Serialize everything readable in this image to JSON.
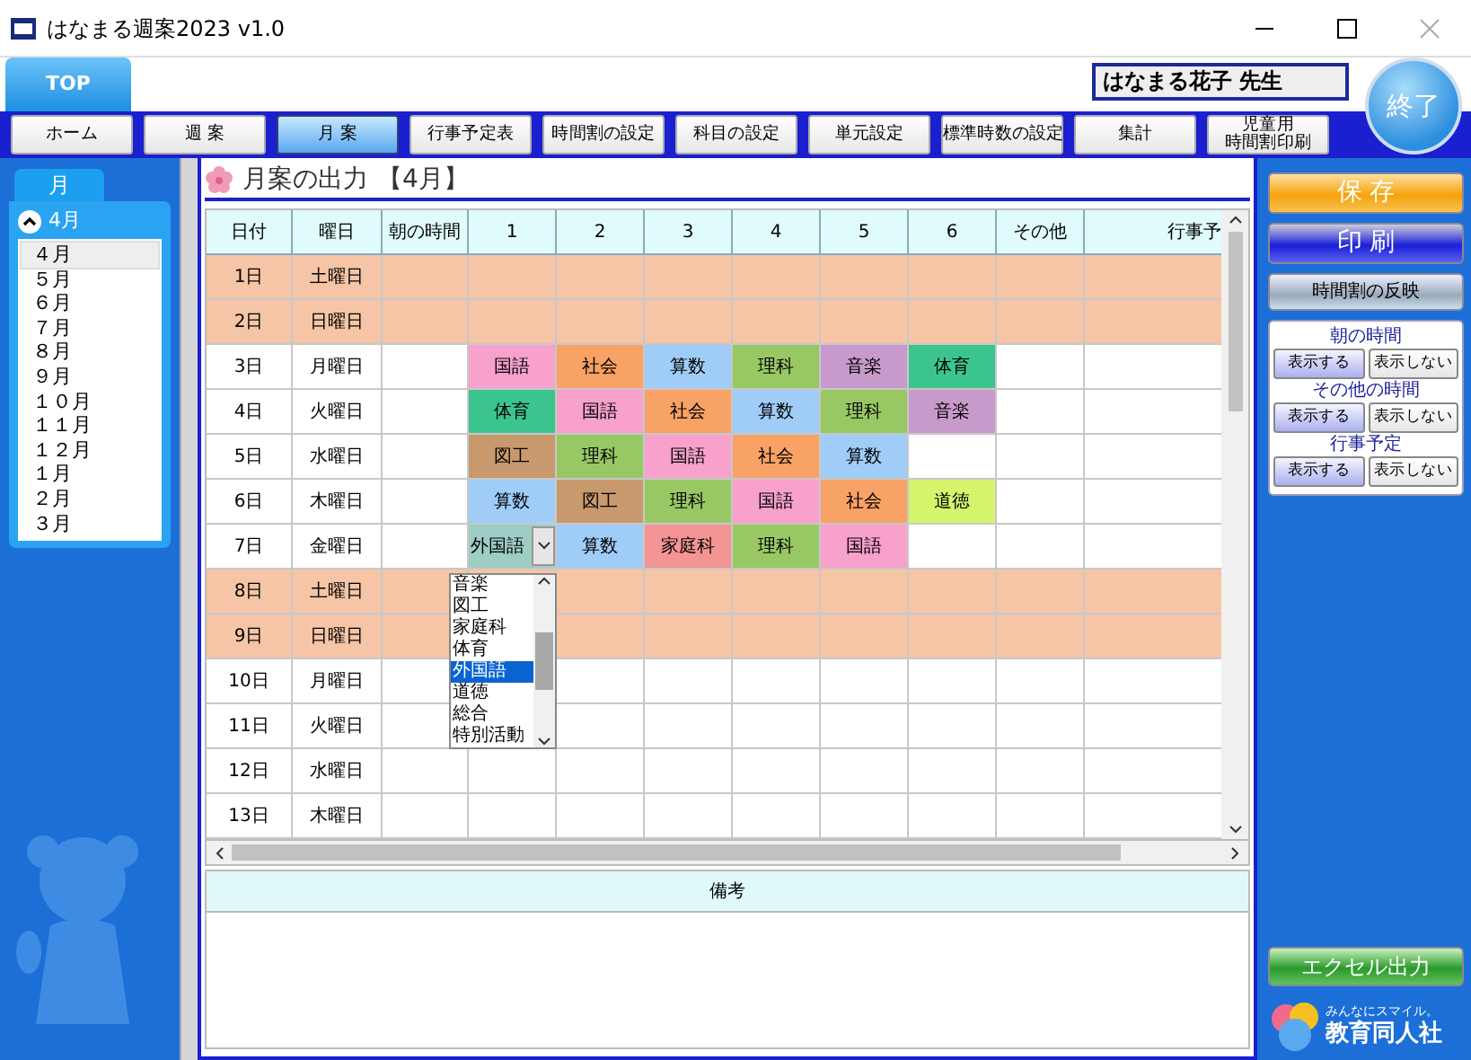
{
  "window": {
    "title": "はなまる週案2023 v1.0"
  },
  "top_tab": {
    "label": "TOP",
    "selected": true
  },
  "teacher": "はなまる花子 先生",
  "exit_button": "終了",
  "nav": [
    {
      "lines": [
        "ホーム"
      ],
      "selected": false
    },
    {
      "lines": [
        "週 案"
      ],
      "selected": false
    },
    {
      "lines": [
        "月 案"
      ],
      "selected": true
    },
    {
      "lines": [
        "行事予定表"
      ],
      "selected": false
    },
    {
      "lines": [
        "時間割の設定"
      ],
      "selected": false
    },
    {
      "lines": [
        "科目の設定"
      ],
      "selected": false
    },
    {
      "lines": [
        "単元設定"
      ],
      "selected": false
    },
    {
      "lines": [
        "標準時数の設定"
      ],
      "selected": false
    },
    {
      "lines": [
        "集計"
      ],
      "selected": false
    },
    {
      "lines": [
        "児童用",
        "時間割印刷"
      ],
      "selected": false
    }
  ],
  "month_panel": {
    "tab": "月",
    "current": "4月",
    "months": [
      {
        "label": "４月",
        "selected": true
      },
      {
        "label": "５月",
        "selected": false
      },
      {
        "label": "６月",
        "selected": false
      },
      {
        "label": "７月",
        "selected": false
      },
      {
        "label": "８月",
        "selected": false
      },
      {
        "label": "９月",
        "selected": false
      },
      {
        "label": "１０月",
        "selected": false
      },
      {
        "label": "１１月",
        "selected": false
      },
      {
        "label": "１２月",
        "selected": false
      },
      {
        "label": "１月",
        "selected": false
      },
      {
        "label": "２月",
        "selected": false
      },
      {
        "label": "３月",
        "selected": false
      }
    ]
  },
  "panel": {
    "title": "月案の出力",
    "month": "【4月】"
  },
  "table": {
    "columns": [
      "日付",
      "曜日",
      "朝の時間",
      "1",
      "2",
      "3",
      "4",
      "5",
      "6",
      "その他",
      "行事予"
    ],
    "rows": [
      {
        "date": "1日",
        "weekday": "土曜日",
        "holiday": true,
        "periods": []
      },
      {
        "date": "2日",
        "weekday": "日曜日",
        "holiday": true,
        "periods": []
      },
      {
        "date": "3日",
        "weekday": "月曜日",
        "holiday": false,
        "periods": [
          {
            "subject": "国語",
            "color": "#f7a1cc"
          },
          {
            "subject": "社会",
            "color": "#f9a266"
          },
          {
            "subject": "算数",
            "color": "#9fcdf8"
          },
          {
            "subject": "理科",
            "color": "#98c864"
          },
          {
            "subject": "音楽",
            "color": "#c79acb"
          },
          {
            "subject": "体育",
            "color": "#3cc48e"
          }
        ]
      },
      {
        "date": "4日",
        "weekday": "火曜日",
        "holiday": false,
        "periods": [
          {
            "subject": "体育",
            "color": "#3cc48e"
          },
          {
            "subject": "国語",
            "color": "#f7a1cc"
          },
          {
            "subject": "社会",
            "color": "#f9a266"
          },
          {
            "subject": "算数",
            "color": "#9fcdf8"
          },
          {
            "subject": "理科",
            "color": "#98c864"
          },
          {
            "subject": "音楽",
            "color": "#c79acb"
          }
        ]
      },
      {
        "date": "5日",
        "weekday": "水曜日",
        "holiday": false,
        "periods": [
          {
            "subject": "図工",
            "color": "#c8996c"
          },
          {
            "subject": "理科",
            "color": "#98c864"
          },
          {
            "subject": "国語",
            "color": "#f7a1cc"
          },
          {
            "subject": "社会",
            "color": "#f9a266"
          },
          {
            "subject": "算数",
            "color": "#9fcdf8"
          }
        ]
      },
      {
        "date": "6日",
        "weekday": "木曜日",
        "holiday": false,
        "periods": [
          {
            "subject": "算数",
            "color": "#9fcdf8"
          },
          {
            "subject": "図工",
            "color": "#c8996c"
          },
          {
            "subject": "理科",
            "color": "#98c864"
          },
          {
            "subject": "国語",
            "color": "#f7a1cc"
          },
          {
            "subject": "社会",
            "color": "#f9a266"
          },
          {
            "subject": "道徳",
            "color": "#d4f56c"
          }
        ]
      },
      {
        "date": "7日",
        "weekday": "金曜日",
        "holiday": false,
        "periods": [
          {
            "subject": "外国語",
            "color": "#9dcdc4",
            "kind": "combo"
          },
          {
            "subject": "算数",
            "color": "#9fcdf8"
          },
          {
            "subject": "家庭科",
            "color": "#f59494"
          },
          {
            "subject": "理科",
            "color": "#98c864"
          },
          {
            "subject": "国語",
            "color": "#f7a1cc"
          }
        ]
      },
      {
        "date": "8日",
        "weekday": "土曜日",
        "holiday": true,
        "periods": []
      },
      {
        "date": "9日",
        "weekday": "日曜日",
        "holiday": true,
        "periods": []
      },
      {
        "date": "10日",
        "weekday": "月曜日",
        "holiday": false,
        "periods": []
      },
      {
        "date": "11日",
        "weekday": "火曜日",
        "holiday": false,
        "periods": []
      },
      {
        "date": "12日",
        "weekday": "水曜日",
        "holiday": false,
        "periods": []
      },
      {
        "date": "13日",
        "weekday": "木曜日",
        "holiday": false,
        "periods": []
      }
    ]
  },
  "dropdown": {
    "options": [
      {
        "label": "音楽",
        "selected": false
      },
      {
        "label": "図工",
        "selected": false
      },
      {
        "label": "家庭科",
        "selected": false
      },
      {
        "label": "体育",
        "selected": false
      },
      {
        "label": "外国語",
        "selected": true
      },
      {
        "label": "道徳",
        "selected": false
      },
      {
        "label": "総合",
        "selected": false
      },
      {
        "label": "特別活動",
        "selected": false
      }
    ]
  },
  "remarks": {
    "header": "備考"
  },
  "side": {
    "save": "保 存",
    "print": "印 刷",
    "apply": "時間割の反映",
    "groups": [
      {
        "title": "朝の時間",
        "options": [
          {
            "label": "表示する",
            "selected": true
          },
          {
            "label": "表示しない",
            "selected": false
          }
        ]
      },
      {
        "title": "その他の時間",
        "options": [
          {
            "label": "表示する",
            "selected": true
          },
          {
            "label": "表示しない",
            "selected": false
          }
        ]
      },
      {
        "title": "行事予定",
        "options": [
          {
            "label": "表示する",
            "selected": true
          },
          {
            "label": "表示しない",
            "selected": false
          }
        ]
      }
    ],
    "excel": "エクセル出力"
  },
  "logo": {
    "tagline": "みんなにスマイル。",
    "name": "教育同人社"
  }
}
